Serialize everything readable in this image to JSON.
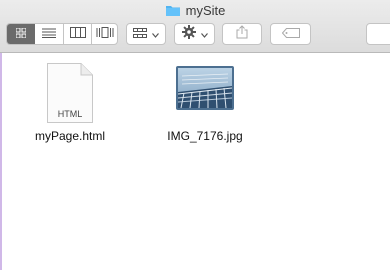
{
  "window": {
    "title": "mySite"
  },
  "toolbar": {
    "view_modes": [
      {
        "icon": "icon-view-icon",
        "active": true
      },
      {
        "icon": "list-view-icon",
        "active": false
      },
      {
        "icon": "column-view-icon",
        "active": false
      },
      {
        "icon": "cover-flow-icon",
        "active": false
      }
    ],
    "arrange_icon": "arrange-icon",
    "action_icon": "gear-icon",
    "share_icon": "share-icon",
    "tag_icon": "tag-icon",
    "accent_color": "#6b6b6b"
  },
  "files": [
    {
      "name": "myPage.html",
      "kind_label": "HTML",
      "type": "html-document"
    },
    {
      "name": "IMG_7176.jpg",
      "type": "image-thumbnail"
    }
  ]
}
